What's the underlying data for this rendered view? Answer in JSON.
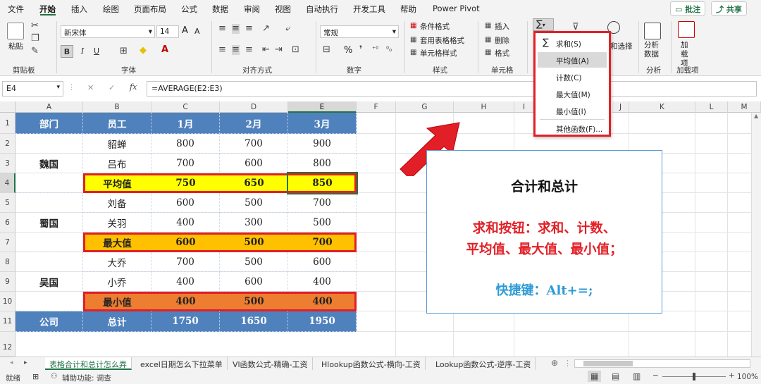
{
  "menu": {
    "tabs": [
      "文件",
      "开始",
      "插入",
      "绘图",
      "页面布局",
      "公式",
      "数据",
      "审阅",
      "视图",
      "自动执行",
      "开发工具",
      "帮助",
      "Power Pivot"
    ],
    "comment_label": "批注",
    "share_label": "共享"
  },
  "ribbon": {
    "clipboard": {
      "paste": "粘贴",
      "label": "剪贴板"
    },
    "font": {
      "name": "新宋体",
      "size": "14",
      "label": "字体",
      "bold": "B",
      "italic": "I",
      "underline": "U",
      "grow": "A",
      "shrink": "A"
    },
    "alignment": {
      "label": "对齐方式"
    },
    "number": {
      "format": "常规",
      "label": "数字",
      "percent": "%"
    },
    "styles": {
      "conditional": "条件格式",
      "table": "套用表格格式",
      "cell": "单元格样式",
      "label": "样式"
    },
    "cells": {
      "insert": "插入",
      "delete": "删除",
      "format": "格式",
      "label": "单元格"
    },
    "editing": {
      "sum_symbol": "∑",
      "select": "和选择"
    },
    "analysis": {
      "btn": "分析数据",
      "label": "分析"
    },
    "addins": {
      "btn": "加载项",
      "label": "加载项"
    }
  },
  "formula_bar": {
    "name_box": "E4",
    "fx": "fx",
    "formula": "=AVERAGE(E2:E3)"
  },
  "sheet": {
    "columns": [
      "A",
      "B",
      "C",
      "D",
      "E",
      "F",
      "G",
      "H",
      "I",
      "J",
      "K",
      "L",
      "M"
    ],
    "rows": [
      "1",
      "2",
      "3",
      "4",
      "5",
      "6",
      "7",
      "8",
      "9",
      "10",
      "11",
      "12"
    ],
    "header": [
      "部门",
      "员工",
      "1月",
      "2月",
      "3月"
    ],
    "groups": [
      "魏国",
      "蜀国",
      "吴国"
    ],
    "data": [
      [
        "貂蝉",
        "800",
        "700",
        "900"
      ],
      [
        "吕布",
        "700",
        "600",
        "800"
      ],
      [
        "平均值",
        "750",
        "650",
        "850"
      ],
      [
        "刘备",
        "600",
        "500",
        "700"
      ],
      [
        "关羽",
        "400",
        "300",
        "500"
      ],
      [
        "最大值",
        "600",
        "500",
        "700"
      ],
      [
        "大乔",
        "700",
        "500",
        "600"
      ],
      [
        "小乔",
        "400",
        "600",
        "400"
      ],
      [
        "最小值",
        "400",
        "500",
        "400"
      ]
    ],
    "footer": [
      "公司",
      "总计",
      "1750",
      "1650",
      "1950"
    ]
  },
  "dropdown": {
    "items": [
      "求和(S)",
      "平均值(A)",
      "计数(C)",
      "最大值(M)",
      "最小值(I)",
      "其他函数(F)..."
    ],
    "highlighted": 1
  },
  "note": {
    "title": "合计和总计",
    "line1": "求和按钮：求和、计数、",
    "line2": "平均值、最大值、最小值；",
    "shortcut": "快捷键：Alt+=;"
  },
  "tabs": [
    "表格合计和总计怎么弄",
    "excel日期怎么下拉菜单",
    "Vl函数公式-精确-工资",
    "Hlookup函数公式-横向-工资",
    "Lookup函数公式-逆序-工资"
  ],
  "status": {
    "ready": "就绪",
    "accessibility": "辅助功能: 调查",
    "zoom": "100%"
  },
  "colors": {
    "header_blue": "#4f81bd",
    "avg_yellow": "#ffff00",
    "max_orange": "#ffc000",
    "min_orange": "#ed7d31",
    "highlight_red": "#e21f26",
    "excel_green": "#217346"
  }
}
